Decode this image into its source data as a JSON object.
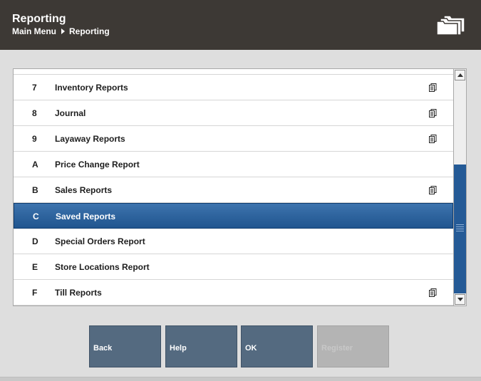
{
  "header": {
    "title": "Reporting",
    "breadcrumb": [
      "Main Menu",
      "Reporting"
    ]
  },
  "list": {
    "rows": [
      {
        "key": "7",
        "label": "Inventory Reports",
        "has_doc_icon": true
      },
      {
        "key": "8",
        "label": "Journal",
        "has_doc_icon": true
      },
      {
        "key": "9",
        "label": "Layaway Reports",
        "has_doc_icon": true
      },
      {
        "key": "A",
        "label": "Price Change Report",
        "has_doc_icon": false
      },
      {
        "key": "B",
        "label": "Sales Reports",
        "has_doc_icon": true
      },
      {
        "key": "C",
        "label": "Saved Reports",
        "has_doc_icon": false,
        "selected": true
      },
      {
        "key": "D",
        "label": "Special Orders Report",
        "has_doc_icon": false
      },
      {
        "key": "E",
        "label": "Store Locations Report",
        "has_doc_icon": false
      },
      {
        "key": "F",
        "label": "Till Reports",
        "has_doc_icon": true
      }
    ],
    "selected_color": "#2a5f9a"
  },
  "buttons": {
    "back": "Back",
    "help": "Help",
    "ok": "OK",
    "register": "Register"
  },
  "colors": {
    "header_bg": "#3d3935",
    "button_bg": "#546a80",
    "button_disabled_bg": "#b4b4b4",
    "page_bg": "#dedede"
  },
  "icons": {
    "header": "folders-icon",
    "row": "document-icon"
  }
}
